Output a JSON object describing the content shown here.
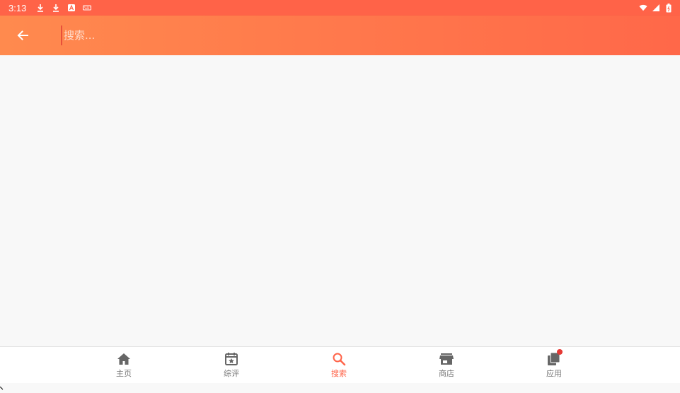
{
  "status_bar": {
    "time": "3:13",
    "icons": [
      "download-icon",
      "download-icon",
      "font-a-icon",
      "keyboard-icon"
    ],
    "right_icons": [
      "wifi-icon",
      "signal-icon",
      "battery-icon"
    ]
  },
  "app_bar": {
    "back_icon": "arrow-left-icon",
    "search_placeholder": "搜索..."
  },
  "bottom_nav": {
    "items": [
      {
        "label": "主页",
        "icon": "home-icon",
        "active": false
      },
      {
        "label": "综评",
        "icon": "calendar-star-icon",
        "active": false
      },
      {
        "label": "搜索",
        "icon": "search-icon",
        "active": true
      },
      {
        "label": "商店",
        "icon": "store-icon",
        "active": false
      },
      {
        "label": "应用",
        "icon": "apps-copy-icon",
        "active": false,
        "badge": true
      }
    ]
  },
  "colors": {
    "status_bar": "#ff6348",
    "app_bar_start": "#ff8a4e",
    "app_bar_end": "#ff6849",
    "active": "#ff6348",
    "inactive": "#777777",
    "badge": "#e53935"
  }
}
